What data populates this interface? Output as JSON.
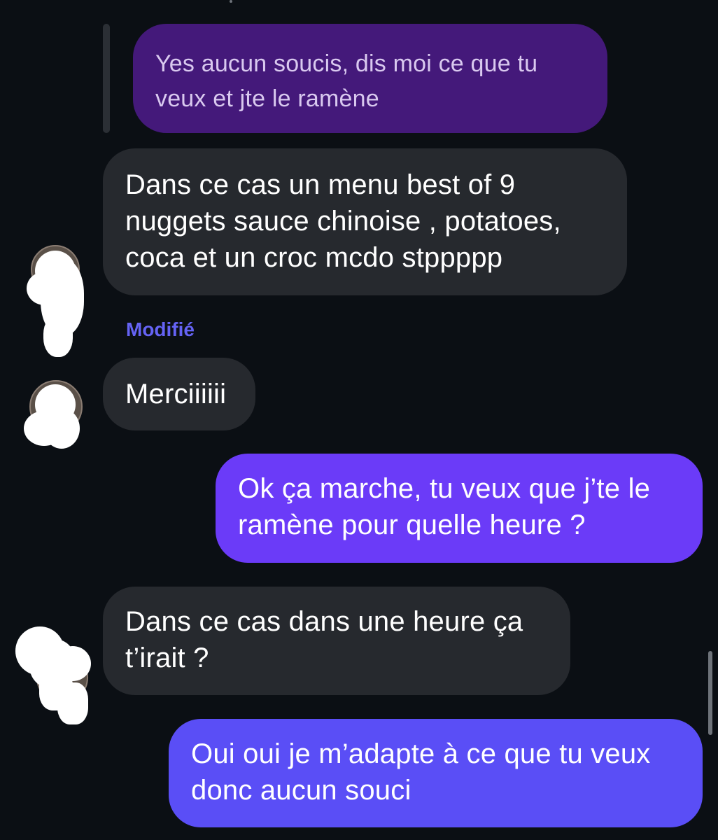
{
  "conversation": {
    "quoted_reply": {
      "text": "Yes aucun soucis, dis moi ce que tu\nveux et jte le ramène",
      "color": "#44197a"
    },
    "messages": [
      {
        "id": "msg1",
        "direction": "incoming",
        "text": "Dans ce cas un menu best of 9\nnuggets  sauce chinoise , potatoes,\ncoca et un croc mcdo stppppp"
      },
      {
        "id": "msg2",
        "direction": "incoming",
        "text": "Merciiiiii"
      },
      {
        "id": "msg3",
        "direction": "outgoing",
        "text": "Ok ça marche, tu veux que j’te le\nramène pour quelle heure ?",
        "color": "#6b3bf8"
      },
      {
        "id": "msg4",
        "direction": "incoming",
        "text": "Dans ce cas dans une heure ça\nt’irait ?"
      },
      {
        "id": "msg5",
        "direction": "outgoing",
        "text": "Oui oui je m’adapte à ce que tu veux\ndonc aucun souci",
        "color": "#5a4ef6"
      }
    ],
    "edited_label": "Modifié"
  },
  "colors": {
    "background": "#0b0f14",
    "incoming_bubble": "#26292e",
    "edited_label": "#6563f4"
  }
}
